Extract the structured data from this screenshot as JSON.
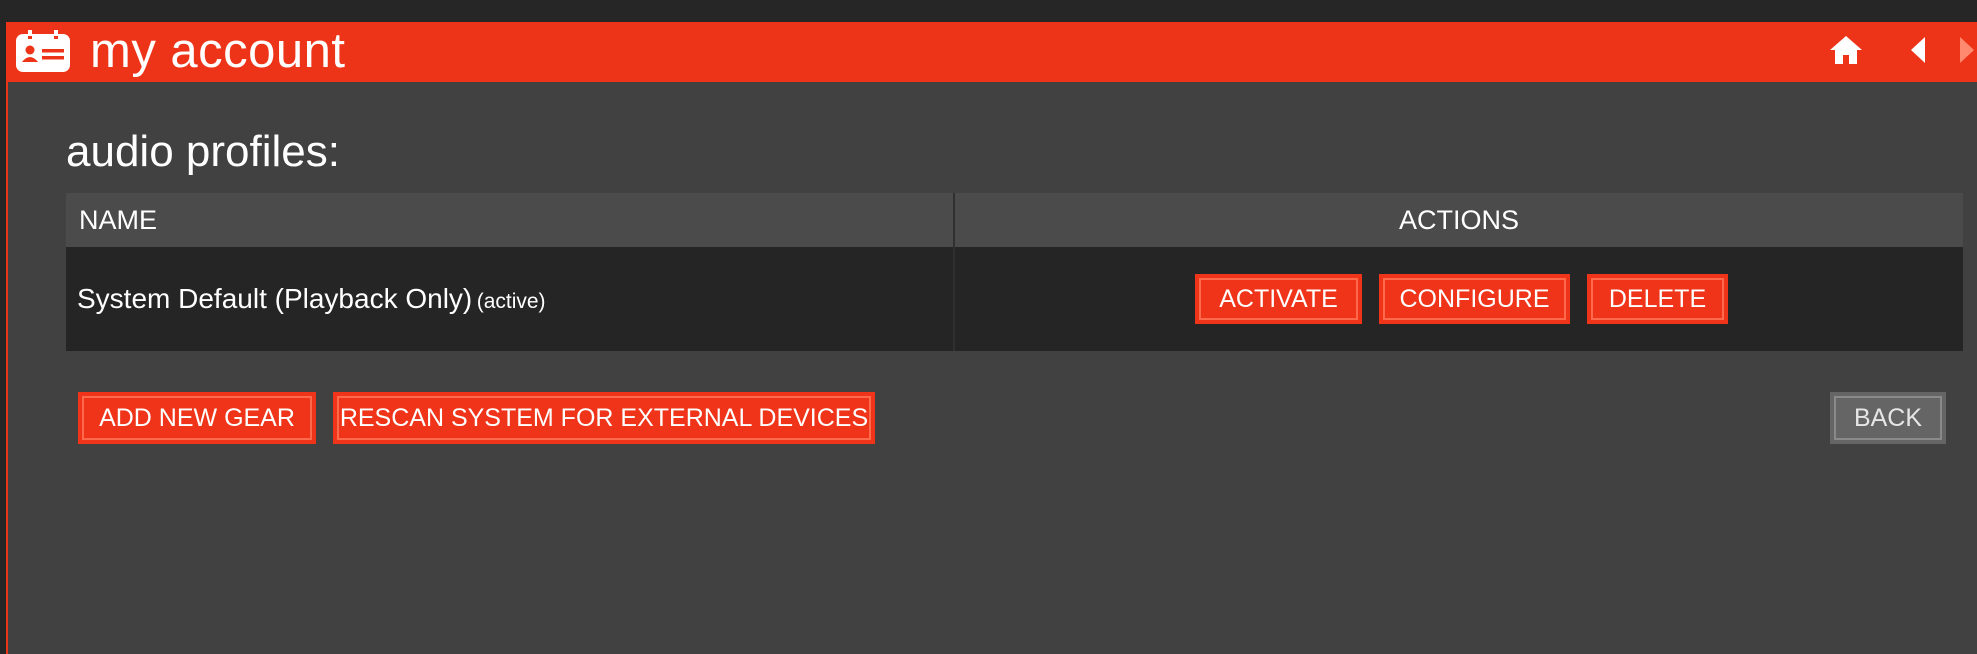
{
  "header": {
    "title": "my account",
    "app_icon": "id-card-icon",
    "nav": {
      "home_icon": "home-icon",
      "back_icon": "chevron-left-icon",
      "forward_icon": "chevron-right-icon"
    }
  },
  "main": {
    "section_title": "audio profiles:",
    "table": {
      "columns": [
        "NAME",
        "ACTIONS"
      ],
      "rows": [
        {
          "name": "System Default (Playback Only)",
          "status": "(active)",
          "actions": [
            "ACTIVATE",
            "CONFIGURE",
            "DELETE"
          ]
        }
      ]
    },
    "buttons": {
      "add_new_gear": "ADD NEW GEAR",
      "rescan": "RESCAN SYSTEM FOR EXTERNAL DEVICES",
      "back": "BACK"
    }
  },
  "colors": {
    "accent": "#ee3418",
    "background": "#414141",
    "table_header": "#4b4b4b",
    "table_row": "#252525"
  }
}
